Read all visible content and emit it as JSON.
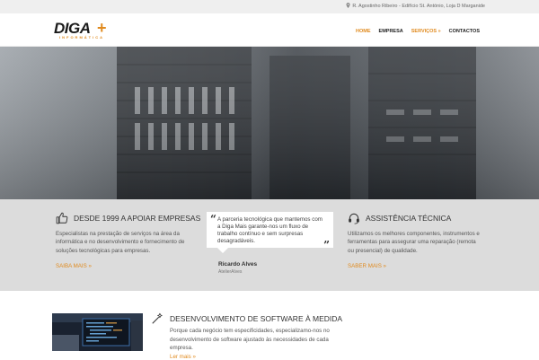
{
  "topbar": {
    "icon": "map-pin-icon",
    "address": "R. Agostinho Ribeiro - Edifício St. António, Loja D Marganide"
  },
  "header": {
    "logo": {
      "word": "DIGA",
      "plus": "+",
      "subtitle": "INFORMÁTICA"
    },
    "nav": [
      {
        "label": "HOME",
        "active": true
      },
      {
        "label": "EMPRESA",
        "active": false
      },
      {
        "label": "SERVIÇOS",
        "suffix": "»",
        "active": false
      },
      {
        "label": "CONTACTOS",
        "active": false
      }
    ]
  },
  "colors": {
    "accent": "#e08a1e",
    "features_bg": "#dcdcdc",
    "topbar_bg": "#efefef"
  },
  "features": {
    "left": {
      "icon": "thumbs-up-icon",
      "title": "DESDE 1999 A APOIAR EMPRESAS",
      "body": "Especialistas na prestação de serviços na área da informática e no desenvolvimento e fornecimento de soluções tecnológicas para empresas.",
      "link": "SAIBA MAIS »"
    },
    "testimonial": {
      "quote": "A parceria tecnológica que mantemos com a Diga Mais garante-nos um fluxo de trabalho contínuo e sem surpresas desagradáveis.",
      "author": "Ricardo Alves",
      "company": "AtelierAlves"
    },
    "right": {
      "icon": "headset-icon",
      "title": "ASSISTÊNCIA TÉCNICA",
      "body": "Utilizamos os melhores componentes, instrumentos e ferramentas para assegurar uma reparação (remota ou presencial) de qualidade.",
      "link": "SABER MAIS »"
    }
  },
  "service": {
    "icon": "magic-wand-icon",
    "title": "DESENVOLVIMENTO DE SOFTWARE À MEDIDA",
    "body": "Porque cada negócio tem especificidades, especializamo-nos no desenvolvimento de software ajustado às necessidades de cada empresa.",
    "link": "Ler mais »"
  }
}
